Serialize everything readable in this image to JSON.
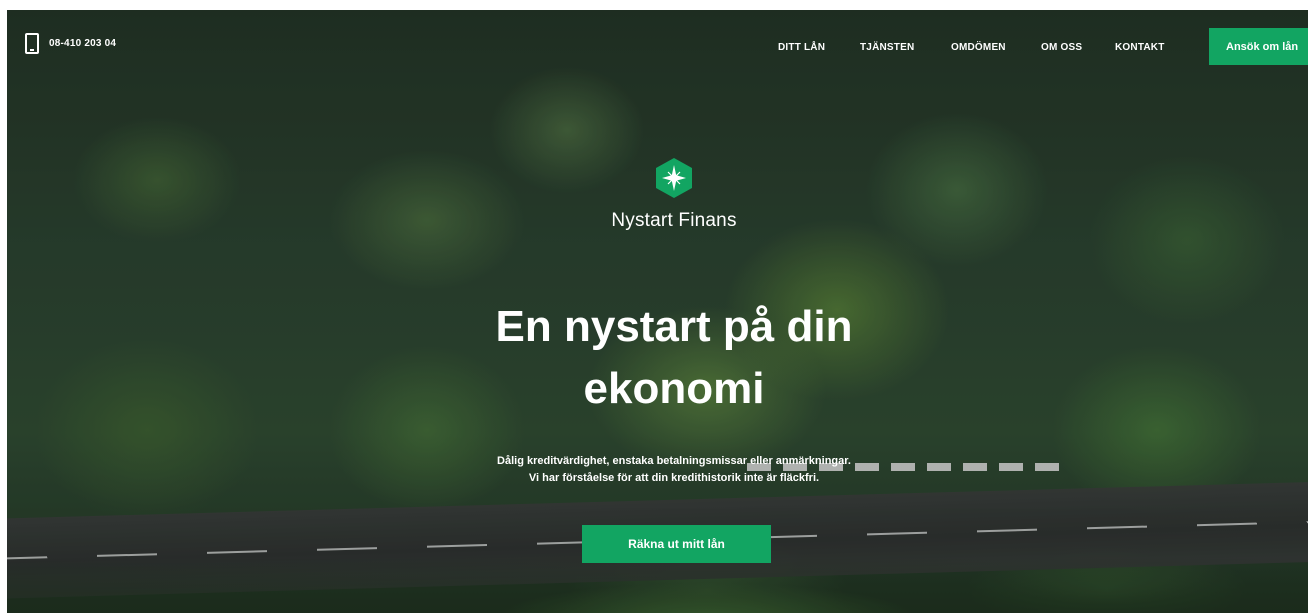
{
  "header": {
    "phone_number": "08-410 203 04",
    "nav": [
      {
        "label": "DITT LÅN"
      },
      {
        "label": "TJÄNSTEN"
      },
      {
        "label": "OMDÖMEN"
      },
      {
        "label": "OM OSS"
      },
      {
        "label": "KONTAKT"
      }
    ],
    "apply_label": "Ansök om lån"
  },
  "hero": {
    "brand": "Nystart Finans",
    "headline_line1": "En nystart på din",
    "headline_line2": "ekonomi",
    "sub_line1": "Dålig kreditvärdighet, enstaka betalningsmissar eller anmärkningar.",
    "sub_line2": "Vi har förståelse för att din kredithistorik inte är fläckfri.",
    "cta_label": "Räkna ut mitt lån"
  },
  "colors": {
    "accent": "#12a562"
  },
  "icons": {
    "phone": "mobile-phone-icon",
    "logo": "hexagon-star-logo"
  }
}
